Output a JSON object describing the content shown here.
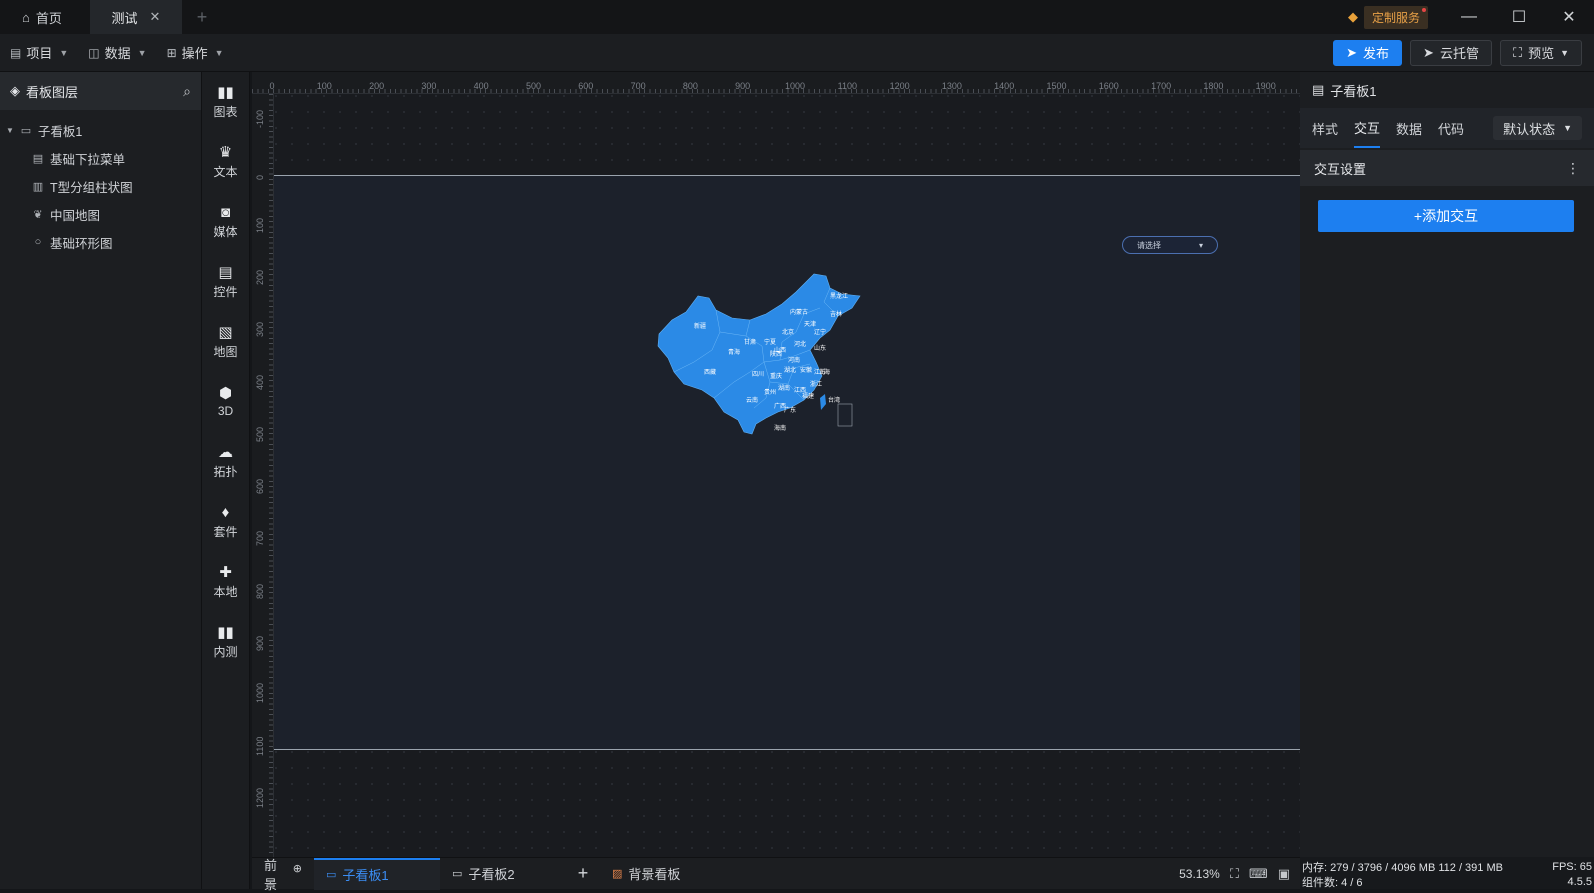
{
  "titlebar": {
    "tabs": [
      {
        "label": "首页",
        "icon": "home-icon"
      },
      {
        "label": "测试",
        "icon": "close-icon"
      }
    ],
    "custom_service": "定制服务"
  },
  "toolbar": {
    "menus": [
      "项目",
      "数据",
      "操作"
    ],
    "buttons": {
      "publish": "发布",
      "cloud": "云托管",
      "preview": "预览"
    }
  },
  "layers": {
    "title": "看板图层",
    "root": "子看板1",
    "children": [
      "基础下拉菜单",
      "T型分组柱状图",
      "中国地图",
      "基础环形图"
    ]
  },
  "rail": [
    "图表",
    "文本",
    "媒体",
    "控件",
    "地图",
    "3D",
    "拓扑",
    "套件",
    "本地",
    "内测"
  ],
  "canvas": {
    "ruler_top": [
      "0",
      "100",
      "200",
      "300",
      "400",
      "500",
      "600",
      "700",
      "800",
      "900",
      "1000",
      "1100",
      "1200",
      "1300",
      "1400",
      "1500",
      "1600",
      "1700",
      "1800",
      "1900"
    ],
    "ruler_left": [
      "-100",
      "0",
      "100",
      "200",
      "300",
      "400",
      "500",
      "600",
      "700",
      "800",
      "900",
      "1000",
      "1100",
      "1200"
    ],
    "select_placeholder": "请选择",
    "map_labels": [
      "新疆",
      "西藏",
      "青海",
      "甘肃",
      "内蒙古",
      "黑龙江",
      "吉林",
      "辽宁",
      "河北",
      "北京",
      "天津",
      "山西",
      "陕西",
      "宁夏",
      "河南",
      "山东",
      "四川",
      "重庆",
      "湖北",
      "湖南",
      "安徽",
      "江苏",
      "上海",
      "浙江",
      "江西",
      "福建",
      "贵州",
      "云南",
      "广西",
      "广东",
      "海南",
      "台湾"
    ]
  },
  "bottom": {
    "foreground": "前景",
    "tabs": [
      "子看板1",
      "子看板2"
    ],
    "background_board": "背景看板",
    "zoom": "53.13%"
  },
  "props": {
    "title": "子看板1",
    "tabs": [
      "样式",
      "交互",
      "数据",
      "代码"
    ],
    "state": "默认状态",
    "section": "交互设置",
    "add_button": "+添加交互",
    "status_memory": "内存: 279 / 3796 / 4096 MB  112 / 391 MB",
    "status_fps": "FPS: 65",
    "status_components": "组件数: 4 / 6",
    "version": "4.5.5"
  },
  "colors": {
    "accent": "#1d7ff0",
    "map_fill": "#2b8ae6"
  }
}
